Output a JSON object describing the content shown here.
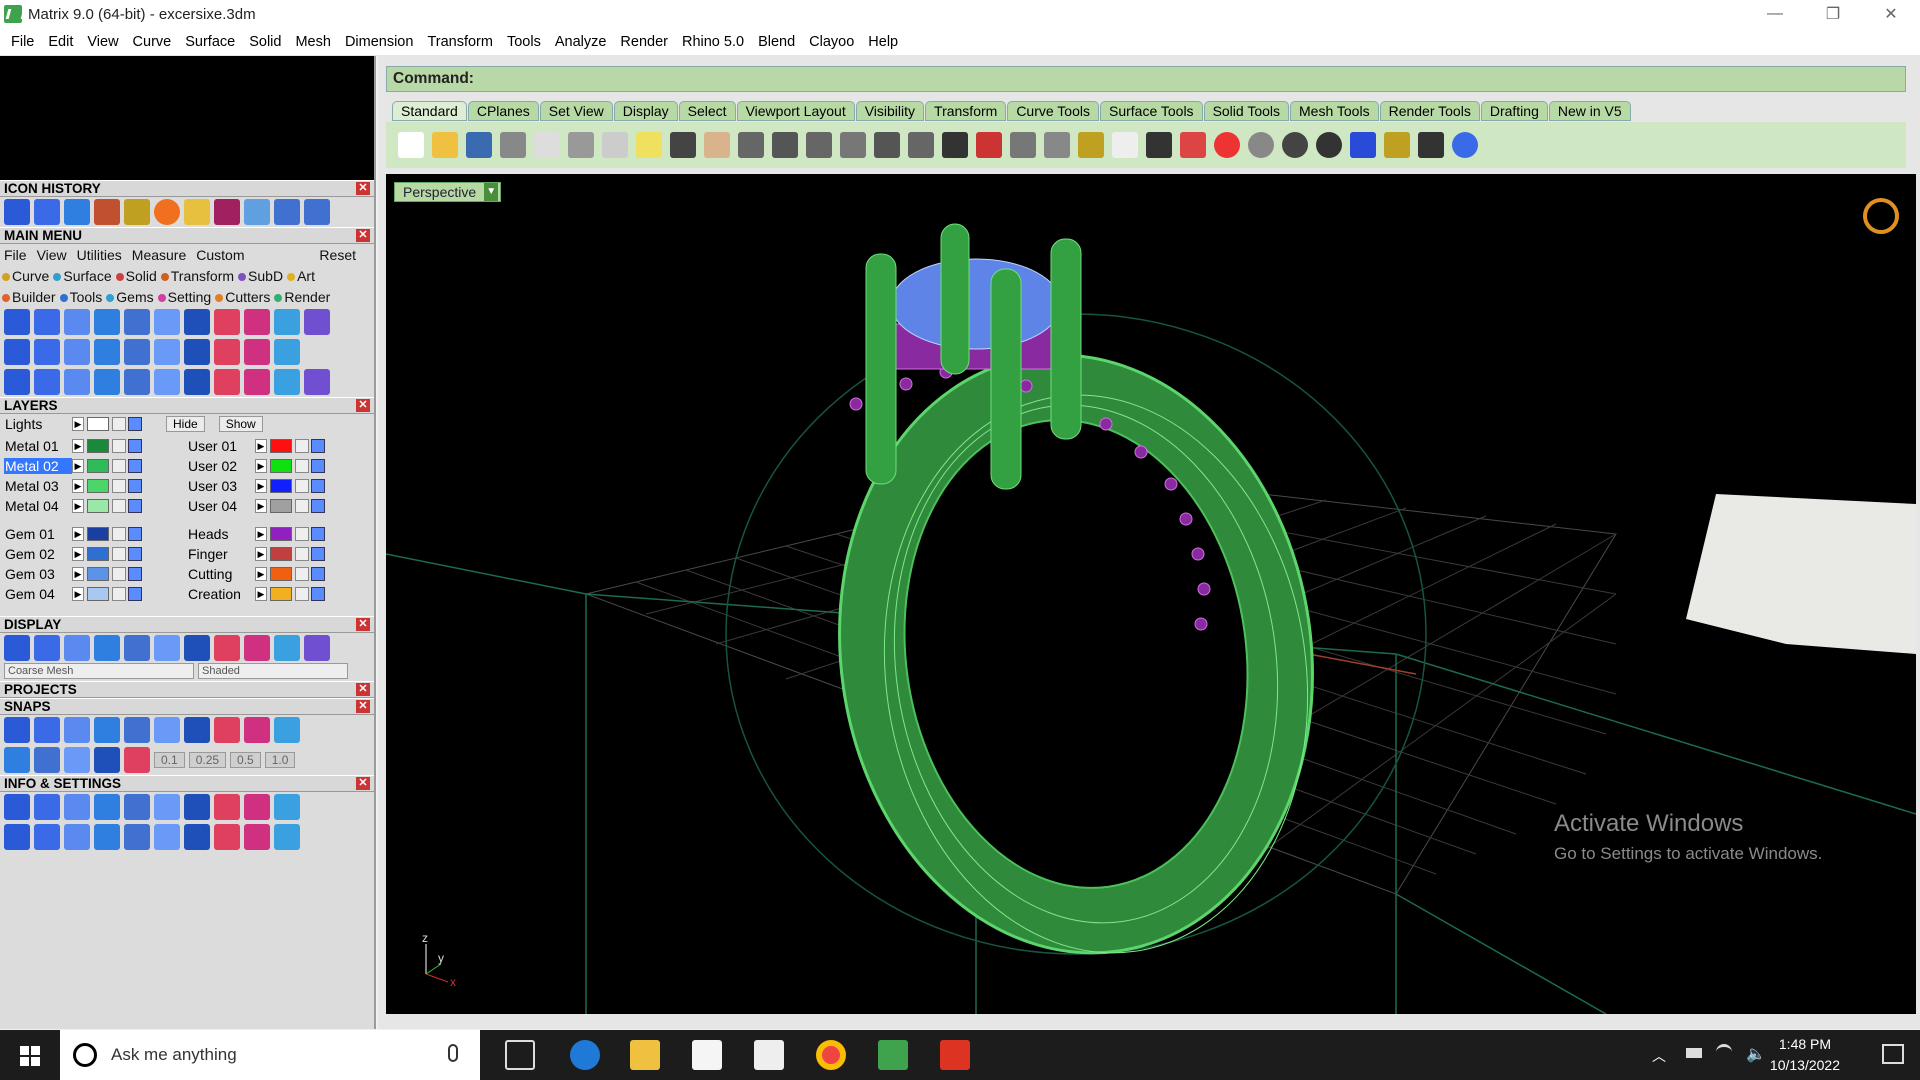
{
  "window": {
    "title": "Matrix 9.0 (64-bit) - excersixe.3dm",
    "minimize": "—",
    "restore": "❐",
    "close": "✕"
  },
  "menubar": [
    "File",
    "Edit",
    "View",
    "Curve",
    "Surface",
    "Solid",
    "Mesh",
    "Dimension",
    "Transform",
    "Tools",
    "Analyze",
    "Render",
    "Rhino 5.0",
    "Blend",
    "Clayoo",
    "Help"
  ],
  "left": {
    "icon_history": "ICON HISTORY",
    "main_menu": "MAIN MENU",
    "mm_row1": [
      "File",
      "View",
      "Utilities",
      "Measure",
      "Custom"
    ],
    "mm_reset": "Reset",
    "mm_row2": [
      {
        "label": "Curve",
        "color": "#d4a020"
      },
      {
        "label": "Surface",
        "color": "#30a0d0"
      },
      {
        "label": "Solid",
        "color": "#d04040"
      },
      {
        "label": "Transform",
        "color": "#d06020"
      },
      {
        "label": "SubD",
        "color": "#8050c0"
      },
      {
        "label": "Art",
        "color": "#e0b020"
      }
    ],
    "mm_row3": [
      {
        "label": "Builder",
        "color": "#e06030"
      },
      {
        "label": "Tools",
        "color": "#3070d0"
      },
      {
        "label": "Gems",
        "color": "#30a0d0"
      },
      {
        "label": "Setting",
        "color": "#d040a0"
      },
      {
        "label": "Cutters",
        "color": "#e08020"
      },
      {
        "label": "Render",
        "color": "#30b070"
      }
    ],
    "layers": "LAYERS",
    "lights": "Lights",
    "hide": "Hide",
    "show": "Show",
    "layers_left": [
      {
        "name": "Metal 01",
        "color": "#1a8a3a"
      },
      {
        "name": "Metal 02",
        "color": "#2fbb5a",
        "selected": true
      },
      {
        "name": "Metal 03",
        "color": "#4cd66a"
      },
      {
        "name": "Metal 04",
        "color": "#9ae8a8"
      },
      {
        "name": "Gem 01",
        "color": "#1b3fa0"
      },
      {
        "name": "Gem 02",
        "color": "#2f6fd0"
      },
      {
        "name": "Gem 03",
        "color": "#5a93e8"
      },
      {
        "name": "Gem 04",
        "color": "#a9c8f0"
      }
    ],
    "layers_right": [
      {
        "name": "User 01",
        "color": "#ff1010"
      },
      {
        "name": "User 02",
        "color": "#10e010"
      },
      {
        "name": "User 03",
        "color": "#1020ff"
      },
      {
        "name": "User 04",
        "color": "#a0a0a0"
      },
      {
        "name": "Heads",
        "color": "#9020c0"
      },
      {
        "name": "Finger",
        "color": "#c04040"
      },
      {
        "name": "Cutting",
        "color": "#f06010"
      },
      {
        "name": "Creation",
        "color": "#f0b020"
      }
    ],
    "display": "DISPLAY",
    "mesh_select": "Coarse Mesh",
    "shade_select": "Shaded",
    "projects": "PROJECTS",
    "snaps": "SNAPS",
    "snap_values": [
      "0.1",
      "0.25",
      "0.5",
      "1.0"
    ],
    "info": "INFO & SETTINGS"
  },
  "command": {
    "label": "Command:"
  },
  "tabs": [
    "Standard",
    "CPlanes",
    "Set View",
    "Display",
    "Select",
    "Viewport Layout",
    "Visibility",
    "Transform",
    "Curve Tools",
    "Surface Tools",
    "Solid Tools",
    "Mesh Tools",
    "Render Tools",
    "Drafting",
    "New in V5"
  ],
  "viewport": {
    "name": "Perspective",
    "axis_z": "z",
    "axis_y": "y",
    "axis_x": "x"
  },
  "watermark": {
    "line1": "Activate Windows",
    "line2": "Go to Settings to activate Windows."
  },
  "taskbar": {
    "search_placeholder": "Ask me anything",
    "time": "1:48 PM",
    "date": "10/13/2022"
  }
}
